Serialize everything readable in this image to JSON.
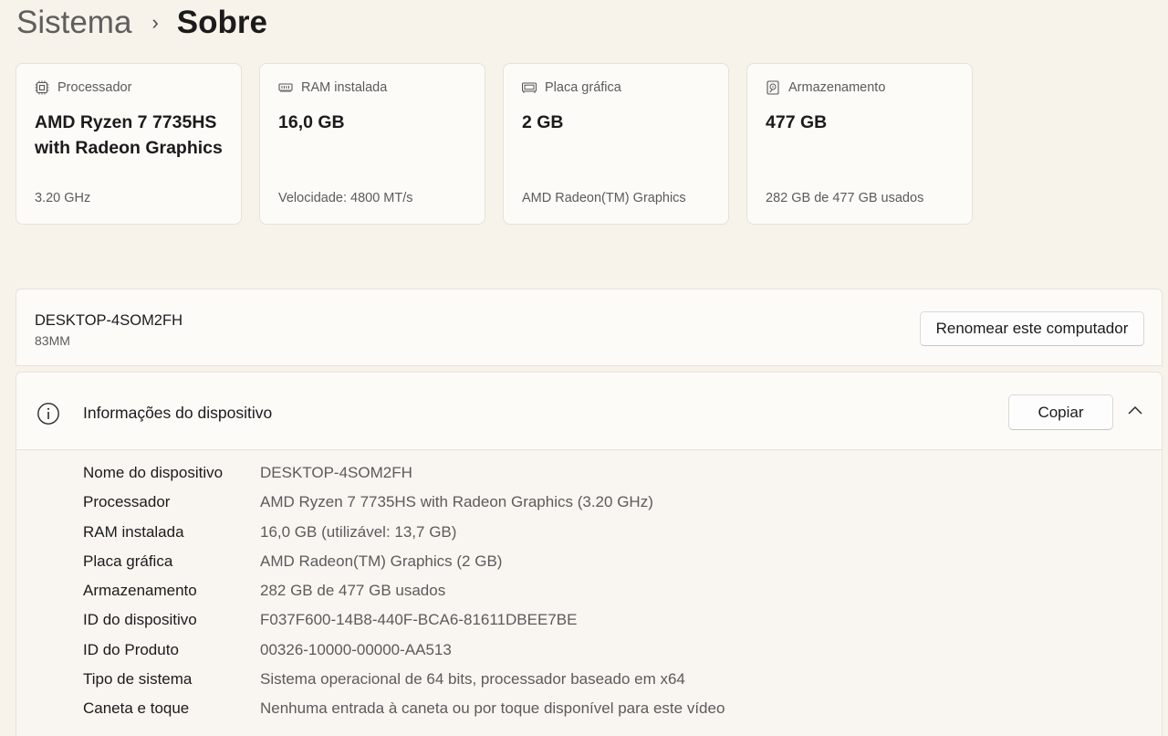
{
  "breadcrumb": {
    "parent": "Sistema",
    "separator": "›",
    "current": "Sobre"
  },
  "cards": {
    "cpu": {
      "icon": "processor-icon",
      "label": "Processador",
      "value": "AMD Ryzen 7 7735HS with Radeon Graphics",
      "sub": "3.20 GHz"
    },
    "ram": {
      "icon": "ram-icon",
      "label": "RAM instalada",
      "value": "16,0 GB",
      "sub": "Velocidade: 4800 MT/s"
    },
    "gpu": {
      "icon": "gpu-icon",
      "label": "Placa gráfica",
      "value": "2 GB",
      "sub": "AMD Radeon(TM) Graphics"
    },
    "storage": {
      "icon": "storage-icon",
      "label": "Armazenamento",
      "value": "477 GB",
      "sub": "282 GB de 477 GB usados"
    }
  },
  "computer": {
    "name": "DESKTOP-4SOM2FH",
    "model": "83MM",
    "rename_label": "Renomear este computador"
  },
  "device_info": {
    "icon": "info-icon",
    "title": "Informações do dispositivo",
    "copy_label": "Copiar",
    "collapse_icon": "chevron-up-icon",
    "rows": [
      {
        "label": "Nome do dispositivo",
        "value": "DESKTOP-4SOM2FH"
      },
      {
        "label": "Processador",
        "value": "AMD Ryzen 7 7735HS with Radeon Graphics (3.20 GHz)"
      },
      {
        "label": "RAM instalada",
        "value": "16,0 GB (utilizável: 13,7 GB)"
      },
      {
        "label": "Placa gráfica",
        "value": "AMD Radeon(TM) Graphics (2 GB)"
      },
      {
        "label": "Armazenamento",
        "value": "282 GB de 477 GB usados"
      },
      {
        "label": "ID do dispositivo",
        "value": "F037F600-14B8-440F-BCA6-81611DBEE7BE"
      },
      {
        "label": "ID do Produto",
        "value": "00326-10000-00000-AA513"
      },
      {
        "label": "Tipo de sistema",
        "value": "Sistema operacional de 64 bits, processador baseado em x64"
      },
      {
        "label": "Caneta e toque",
        "value": "Nenhuma entrada à caneta ou por toque disponível para este vídeo"
      }
    ]
  },
  "colors": {
    "background": "#f7f2ea",
    "card": "#fdfbf8",
    "text": "#1b1b1b",
    "secondary_text": "#5b5b5b"
  }
}
